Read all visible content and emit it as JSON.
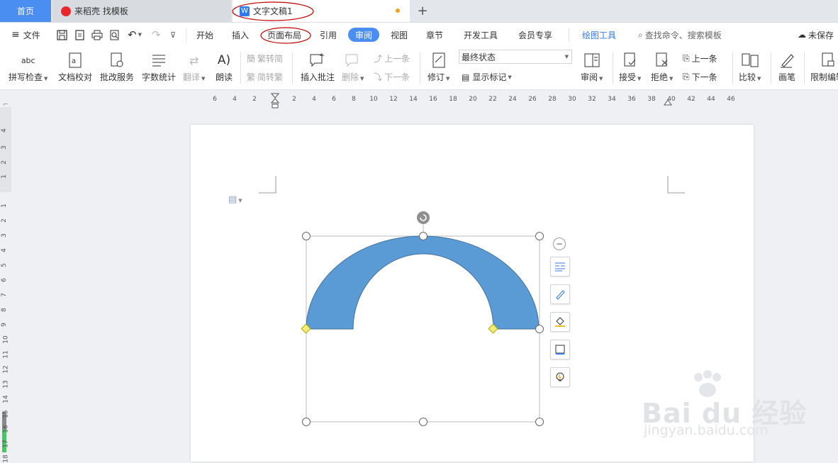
{
  "tabs": {
    "home": "首页",
    "daoke": "来稻壳 找模板",
    "doc": "文字文稿1",
    "new_tab": "+"
  },
  "menu": {
    "file": "文件",
    "items": [
      "开始",
      "插入",
      "页面布局",
      "引用",
      "审阅",
      "视图",
      "章节",
      "开发工具",
      "会员专享"
    ],
    "active": "审阅",
    "drawing_tools": "绘图工具",
    "search": "查找命令、搜索模板",
    "unsaved": "未保存"
  },
  "ribbon": {
    "spellcheck": "拼写检查",
    "doc_proof": "文档校对",
    "revise_service": "批改服务",
    "word_count": "字数统计",
    "translate": "翻译",
    "read_aloud": "朗读",
    "trad_to_simp": "繁转简",
    "simp_to_trad": "简转繁",
    "insert_comment": "插入批注",
    "delete": "删除",
    "prev_comment": "上一条",
    "next_comment": "下一条",
    "revise": "修订",
    "final_status": "最终状态",
    "show_markup": "显示标记",
    "review": "审阅",
    "accept": "接受",
    "reject": "拒绝",
    "prev_change": "上一条",
    "next_change": "下一条",
    "compare": "比较",
    "pen": "画笔",
    "restrict_edit": "限制编辑"
  },
  "ruler": {
    "h_numbers": [
      "6",
      "4",
      "2",
      "2",
      "4",
      "6",
      "8",
      "10",
      "12",
      "14",
      "16",
      "18",
      "20",
      "22",
      "24",
      "26",
      "28",
      "30",
      "32",
      "34",
      "36",
      "38",
      "40",
      "42",
      "44",
      "46"
    ],
    "v_numbers": [
      "4",
      "3",
      "2",
      "1",
      "1",
      "2",
      "3",
      "4",
      "5",
      "6",
      "7",
      "8",
      "9",
      "10",
      "11",
      "12",
      "13",
      "14",
      "15",
      "16",
      "17",
      "18"
    ]
  },
  "watermark": {
    "brand": "Bai du 经验",
    "url": "jingyan.baidu.com"
  },
  "colors": {
    "shape_fill": "#5b9bd5",
    "shape_stroke": "#41719c",
    "accent": "#4b8ef1",
    "annotation": "#c00000"
  }
}
